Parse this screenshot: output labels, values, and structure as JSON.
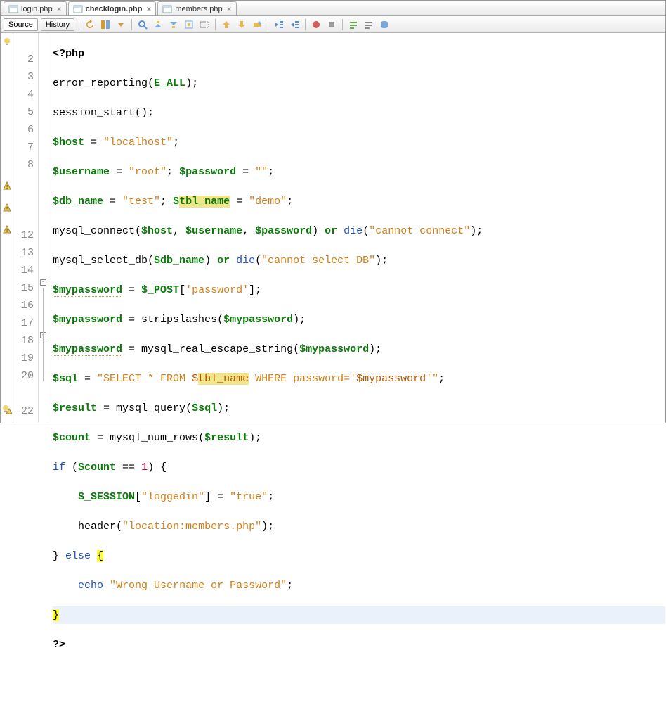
{
  "tabs": [
    {
      "label": "login.php",
      "active": false
    },
    {
      "label": "checklogin.php",
      "active": true
    },
    {
      "label": "members.php",
      "active": false
    }
  ],
  "toolbar": {
    "source": "Source",
    "history": "History"
  },
  "gutter": {
    "marks": [
      "bulb",
      "2",
      "3",
      "4",
      "5",
      "6",
      "7",
      "8",
      "warn",
      "warn",
      "warn",
      "12",
      "13",
      "14",
      "15",
      "16",
      "17",
      "18",
      "19",
      "20",
      "bulbwarn",
      "22"
    ]
  },
  "code": {
    "l1": {
      "a": "<?php"
    },
    "l2": {
      "a": "error_reporting",
      "b": "(",
      "c": "E_ALL",
      "d": ");"
    },
    "l3": {
      "a": "session_start",
      "b": "();"
    },
    "l4": {
      "a": "$host",
      "b": " = ",
      "c": "\"localhost\"",
      "d": ";"
    },
    "l5": {
      "a": "$username",
      "b": " = ",
      "c": "\"root\"",
      "d": "; ",
      "e": "$password",
      "f": " = ",
      "g": "\"\"",
      "h": ";"
    },
    "l6": {
      "a": "$db_name",
      "b": " = ",
      "c": "\"test\"",
      "d": "; ",
      "e": "$",
      "f": "tbl_name",
      "g": " = ",
      "h": "\"demo\"",
      "i": ";"
    },
    "l7": {
      "a": "mysql_connect",
      "b": "(",
      "c": "$host",
      "d": ", ",
      "e": "$username",
      "f": ", ",
      "g": "$password",
      "h": ") ",
      "i": "or",
      "j": " ",
      "k": "die",
      "l": "(",
      "m": "\"cannot connect\"",
      "n": ");"
    },
    "l8": {
      "a": "mysql_select_db",
      "b": "(",
      "c": "$db_name",
      "d": ") ",
      "e": "or",
      "f": " ",
      "g": "die",
      "h": "(",
      "i": "\"cannot select DB\"",
      "j": ");"
    },
    "l9": {
      "a": "$mypassword",
      "b": " = ",
      "c": "$_POST",
      "d": "[",
      "e": "'password'",
      "f": "];"
    },
    "l10": {
      "a": "$mypassword",
      "b": " = ",
      "c": "stripslashes",
      "d": "(",
      "e": "$mypassword",
      "f": ");"
    },
    "l11": {
      "a": "$mypassword",
      "b": " = ",
      "c": "mysql_real_escape_string",
      "d": "(",
      "e": "$mypassword",
      "f": ");"
    },
    "l12": {
      "a": "$sql",
      "b": " = ",
      "c": "\"SELECT * FROM ",
      "d": "$",
      "e": "tbl_name",
      "f": " WHERE password='",
      "g": "$mypassword",
      "h": "'\"",
      "i": ";"
    },
    "l13": {
      "a": "$result",
      "b": " = ",
      "c": "mysql_query",
      "d": "(",
      "e": "$sql",
      "f": ");"
    },
    "l14": {
      "a": "$count",
      "b": " = ",
      "c": "mysql_num_rows",
      "d": "(",
      "e": "$result",
      "f": ");"
    },
    "l15": {
      "a": "if",
      "b": " (",
      "c": "$count",
      "d": " == ",
      "e": "1",
      "f": ") {"
    },
    "l16": {
      "a": "$_SESSION",
      "b": "[",
      "c": "\"loggedin\"",
      "d": "] = ",
      "e": "\"true\"",
      "f": ";"
    },
    "l17": {
      "a": "header",
      "b": "(",
      "c": "\"location:members.php\"",
      "d": ");"
    },
    "l18": {
      "a": "} ",
      "b": "else",
      "c": " ",
      "d": "{"
    },
    "l19": {
      "a": "echo",
      "b": " ",
      "c": "\"Wrong Username or Password\"",
      "d": ";"
    },
    "l20": {
      "a": "}"
    },
    "l21": {
      "a": "?>"
    }
  }
}
